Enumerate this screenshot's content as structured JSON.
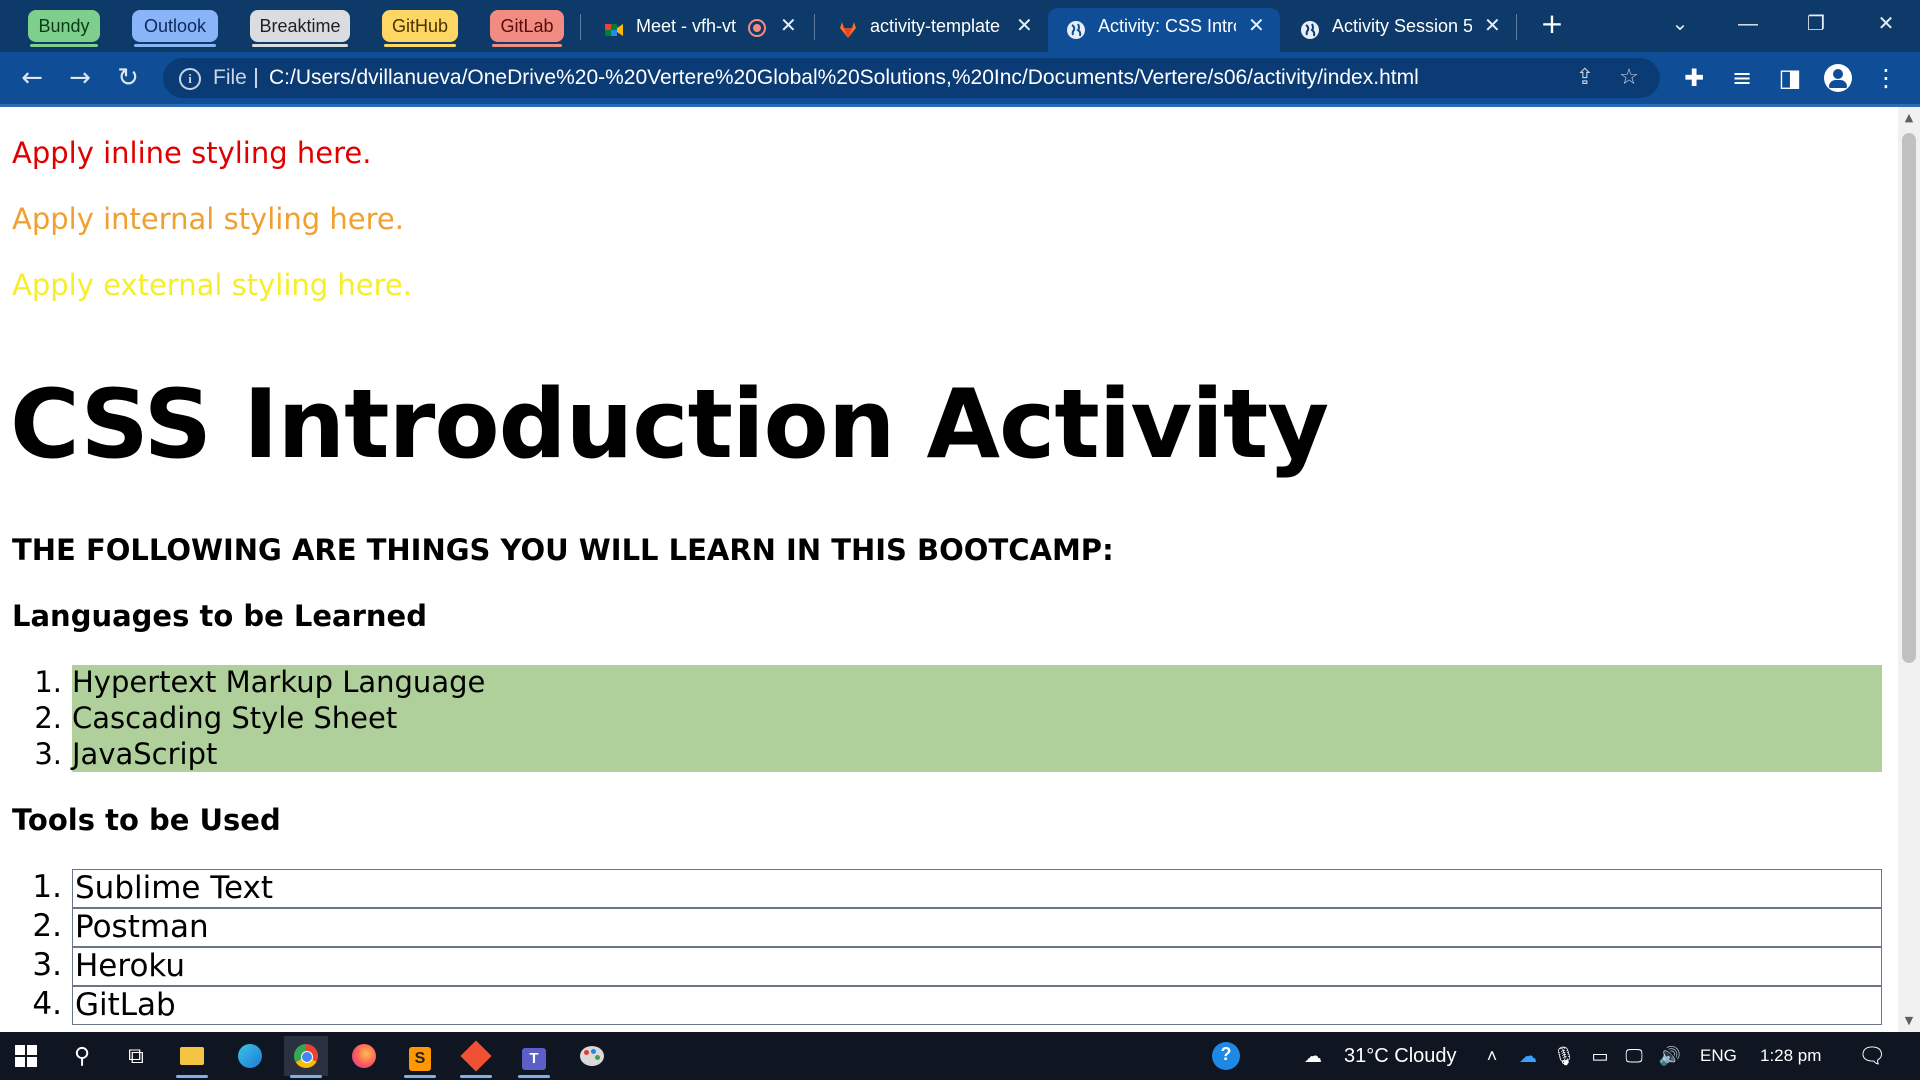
{
  "browser": {
    "tab_groups": [
      {
        "label": "Bundy",
        "bg": "#7fcf8c",
        "fg": "#0b3b18"
      },
      {
        "label": "Outlook",
        "bg": "#8ab4f8",
        "fg": "#0b2a5c"
      },
      {
        "label": "Breaktime",
        "bg": "#dadce0",
        "fg": "#202124"
      },
      {
        "label": "GitHub",
        "bg": "#fdd663",
        "fg": "#4a3300"
      },
      {
        "label": "GitLab",
        "bg": "#f28b82",
        "fg": "#5c0b0b"
      }
    ],
    "tabs": [
      {
        "title": "Meet - vfh-vt",
        "favicon": "google-meet-icon",
        "recording": true,
        "active": false
      },
      {
        "title": "activity-template",
        "favicon": "gitlab-icon",
        "active": false
      },
      {
        "title": "Activity: CSS Intro",
        "favicon": "globe-icon",
        "active": true
      },
      {
        "title": "Activity Session 5",
        "favicon": "globe-icon",
        "active": false
      }
    ],
    "new_tab_symbol": "+",
    "address": {
      "scheme": "File",
      "url": "C:/Users/dvillanueva/OneDrive%20-%20Vertere%20Global%20Solutions,%20Inc/Documents/Vertere/s06/activity/index.html"
    }
  },
  "page": {
    "inline_text": "Apply inline styling here.",
    "internal_text": "Apply internal styling here.",
    "external_text": "Apply external styling here.",
    "title": "CSS Introduction Activity",
    "subtitle": "THE FOLLOWING ARE THINGS YOU WILL LEARN IN THIS BOOTCAMP:",
    "languages_heading": "Languages to be Learned",
    "languages": [
      "Hypertext Markup Language",
      "Cascading Style Sheet",
      "JavaScript"
    ],
    "tools_heading": "Tools to be Used",
    "tools": [
      "Sublime Text",
      "Postman",
      "Heroku",
      "GitLab"
    ],
    "list_numbers": [
      "1.",
      "2.",
      "3.",
      "4."
    ],
    "colors": {
      "inline": "#e00000",
      "internal": "#f0a030",
      "external": "#f5ef2a",
      "languages_band": "#afd09b"
    }
  },
  "taskbar": {
    "weather": "31°C  Cloudy",
    "language": "ENG",
    "time": "1:28 pm"
  }
}
